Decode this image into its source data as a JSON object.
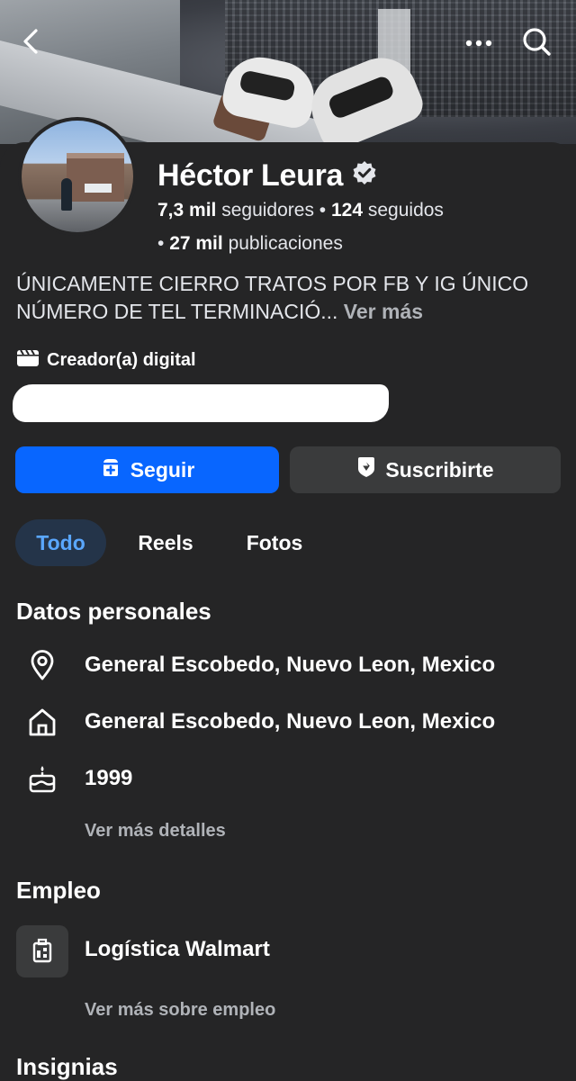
{
  "profile": {
    "name": "Héctor Leura",
    "followers_count": "7,3 mil",
    "followers_label": "seguidores",
    "following_count": "124",
    "following_label": "seguidos",
    "posts_count": "27 mil",
    "posts_label": "publicaciones",
    "bio": "ÚNICAMENTE CIERRO TRATOS POR FB Y IG ÚNICO NÚMERO DE TEL TERMINACIÓ...",
    "bio_more": "Ver más",
    "category": "Creador(a) digital"
  },
  "actions": {
    "follow_label": "Seguir",
    "subscribe_label": "Suscribirte"
  },
  "tabs": [
    {
      "label": "Todo",
      "active": true
    },
    {
      "label": "Reels",
      "active": false
    },
    {
      "label": "Fotos",
      "active": false
    }
  ],
  "personal": {
    "title": "Datos personales",
    "location": "General Escobedo, Nuevo Leon, Mexico",
    "hometown": "General Escobedo, Nuevo Leon, Mexico",
    "birth_year": "1999",
    "more_details": "Ver más detalles"
  },
  "work": {
    "title": "Empleo",
    "employer": "Logística Walmart",
    "more": "Ver más sobre empleo"
  },
  "badges": {
    "title": "Insignias"
  },
  "colors": {
    "background": "#252526",
    "primary_button": "#0866ff",
    "secondary_button": "#3a3b3c",
    "active_tab_bg": "#243449",
    "active_tab_text": "#5aa7ff",
    "muted_text": "#b0b3b8"
  },
  "icons": [
    "back-arrow-icon",
    "more-options-icon",
    "search-icon",
    "verified-badge-icon",
    "clapperboard-icon",
    "follow-plus-icon",
    "subscribe-shield-icon",
    "location-pin-icon",
    "home-icon",
    "birthday-cake-icon",
    "work-building-icon"
  ]
}
